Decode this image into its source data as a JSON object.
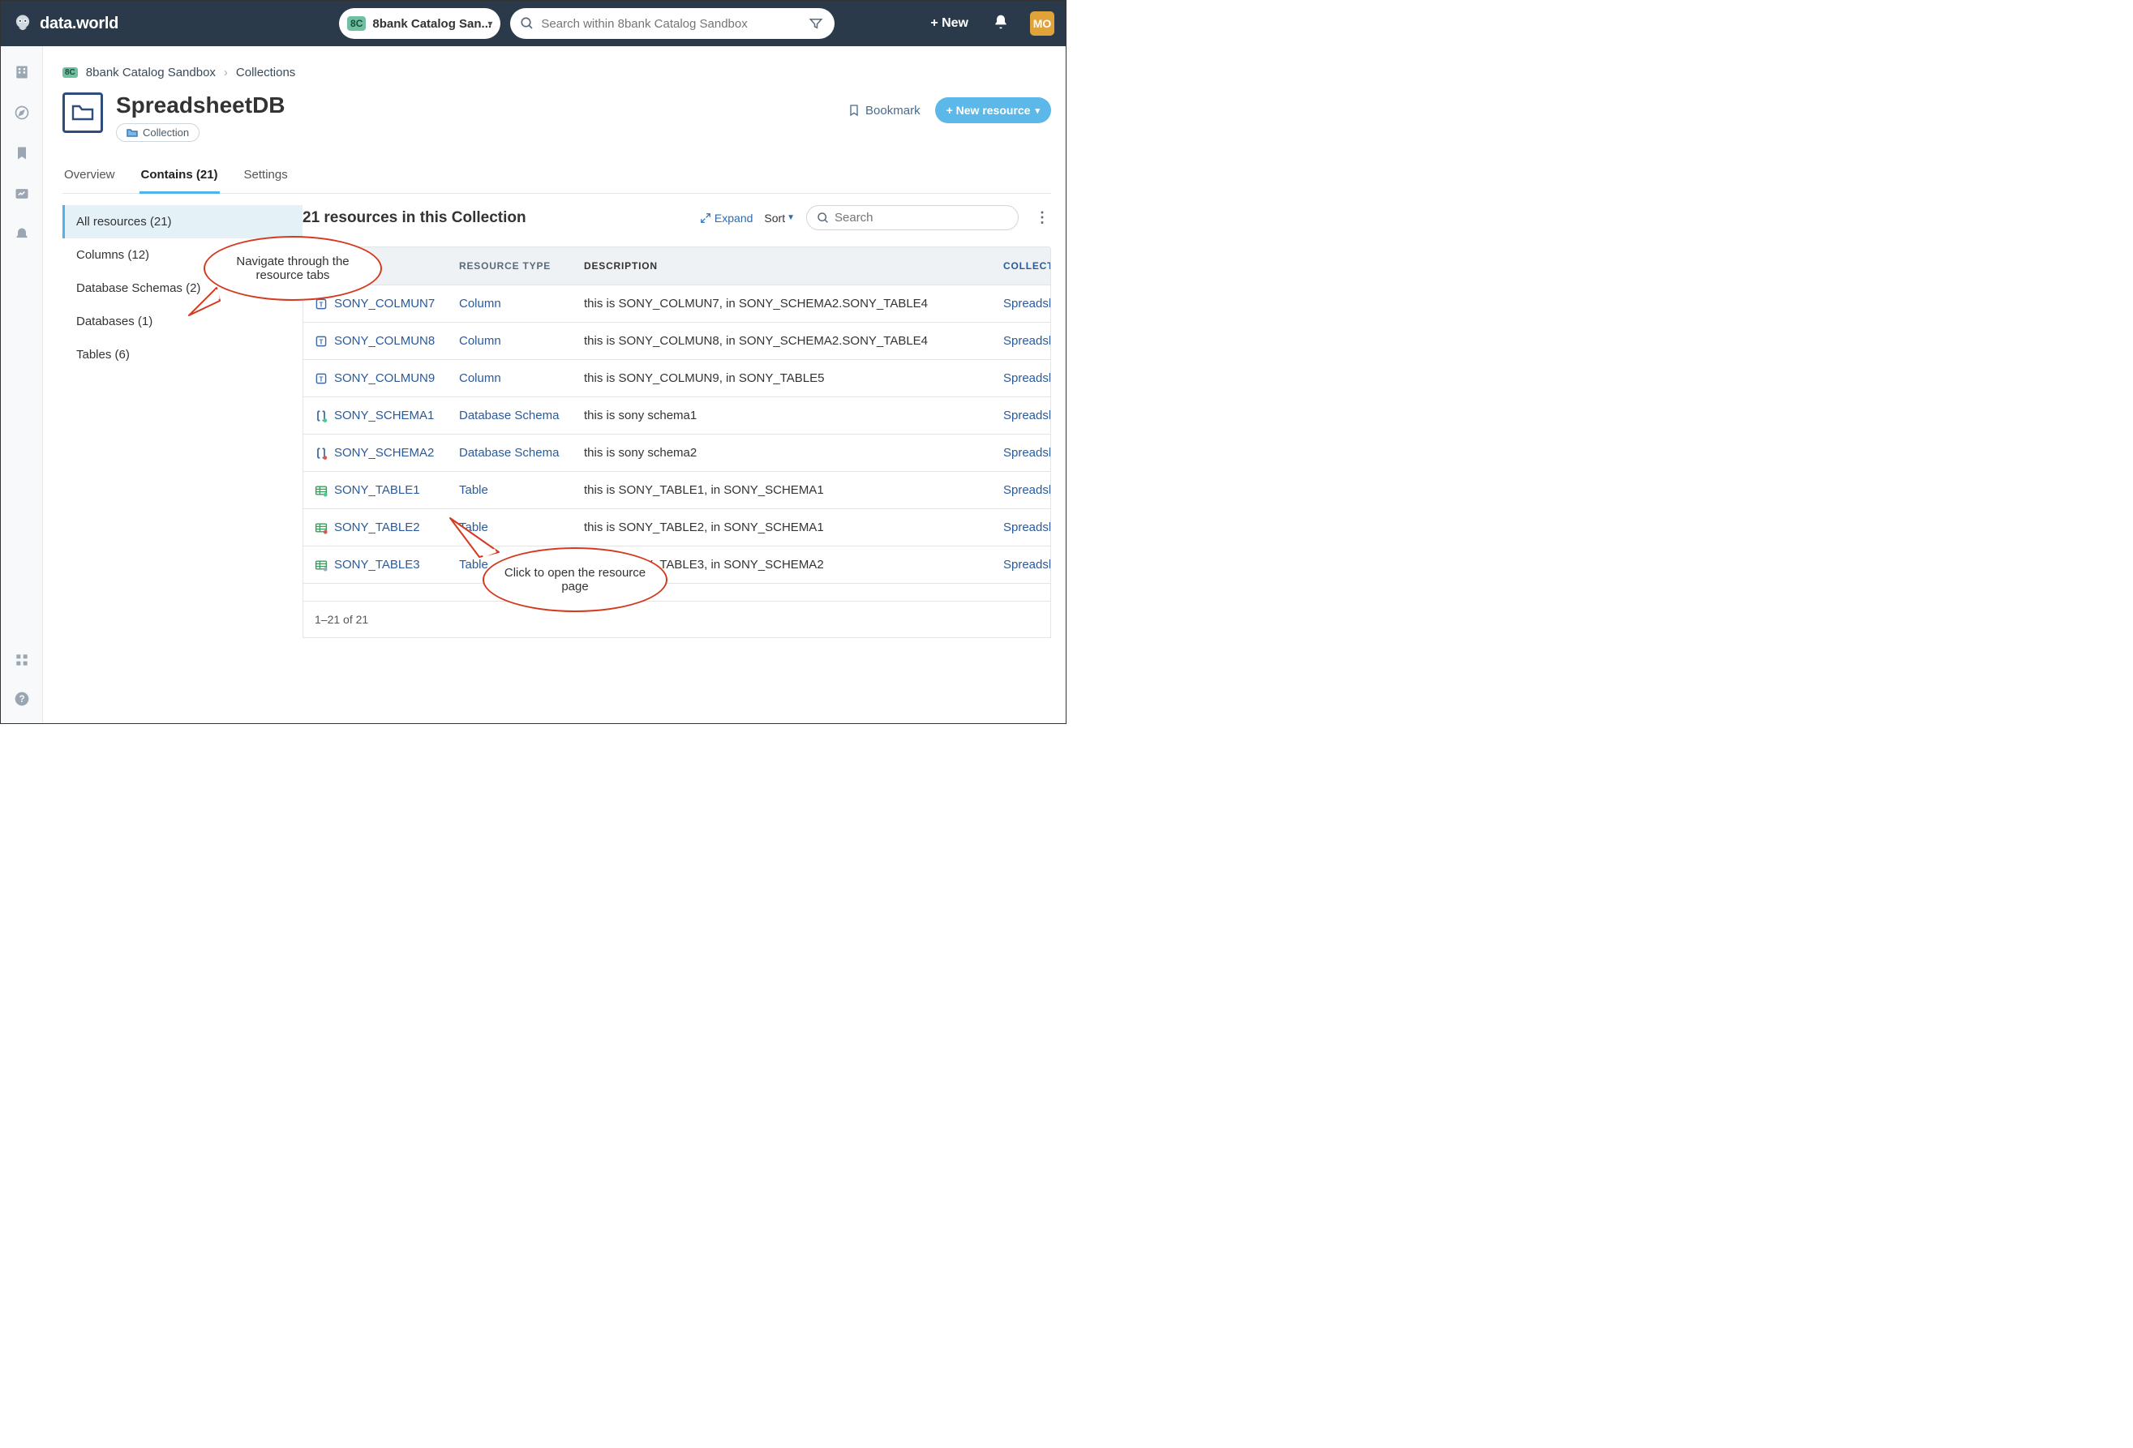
{
  "topbar": {
    "brand": "data.world",
    "catalog_badge": "8C",
    "catalog_label": "8bank Catalog San...",
    "search_placeholder": "Search within 8bank Catalog Sandbox",
    "new_label": "+ New",
    "avatar": "MO"
  },
  "crumbs": {
    "badge": "8C",
    "org": "8bank Catalog Sandbox",
    "section": "Collections"
  },
  "page": {
    "title": "SpreadsheetDB",
    "chip": "Collection",
    "bookmark": "Bookmark",
    "new_resource": "+ New resource"
  },
  "tabs": [
    {
      "label": "Overview"
    },
    {
      "label": "Contains (21)"
    },
    {
      "label": "Settings"
    }
  ],
  "sidebar": [
    {
      "label": "All resources (21)"
    },
    {
      "label": "Columns (12)"
    },
    {
      "label": "Database Schemas (2)"
    },
    {
      "label": "Databases (1)"
    },
    {
      "label": "Tables (6)"
    }
  ],
  "content": {
    "heading": "21 resources in this Collection",
    "expand": "Expand",
    "sort": "Sort",
    "search_placeholder": "Search",
    "columns": {
      "type": "RESOURCE TYPE",
      "desc": "DESCRIPTION",
      "coll": "COLLECT"
    },
    "rows": [
      {
        "name": "SONY_COLMUN7",
        "type": "Column",
        "desc": "this is SONY_COLMUN7, in SONY_SCHEMA2.SONY_TABLE4",
        "coll": "Spreadshe",
        "icon": "column"
      },
      {
        "name": "SONY_COLMUN8",
        "type": "Column",
        "desc": "this is SONY_COLMUN8, in SONY_SCHEMA2.SONY_TABLE4",
        "coll": "Spreadshe",
        "icon": "column"
      },
      {
        "name": "SONY_COLMUN9",
        "type": "Column",
        "desc": "this is SONY_COLMUN9, in SONY_TABLE5",
        "coll": "Spreadshe",
        "icon": "column"
      },
      {
        "name": "SONY_SCHEMA1",
        "type": "Database Schema",
        "desc": "this is sony schema1",
        "coll": "Spreadshe",
        "icon": "schema",
        "dot": "#4c9"
      },
      {
        "name": "SONY_SCHEMA2",
        "type": "Database Schema",
        "desc": "this is sony schema2",
        "coll": "Spreadshe",
        "icon": "schema",
        "dot": "#d55"
      },
      {
        "name": "SONY_TABLE1",
        "type": "Table",
        "desc": "this is SONY_TABLE1, in SONY_SCHEMA1",
        "coll": "Spreadshe",
        "icon": "table",
        "dot": "#4c9"
      },
      {
        "name": "SONY_TABLE2",
        "type": "Table",
        "desc": "this is SONY_TABLE2, in SONY_SCHEMA1",
        "coll": "Spreadshe",
        "icon": "table",
        "dot": "#d55"
      },
      {
        "name": "SONY_TABLE3",
        "type": "Table",
        "desc": "this is SONY_TABLE3, in SONY_SCHEMA2",
        "coll": "Spreadshe",
        "icon": "table",
        "dot": "#9ab"
      }
    ],
    "footer": "1–21 of 21"
  },
  "callouts": {
    "nav": "Navigate through the resource tabs",
    "click": "Click to open the resource page"
  }
}
